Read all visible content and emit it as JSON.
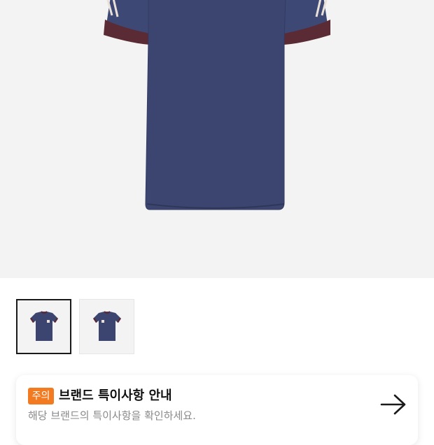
{
  "product": {
    "main_image": "navy-jersey-front",
    "colors": {
      "body": "#3b4570",
      "cuff": "#5a2a35",
      "background": "#f3f3f3"
    }
  },
  "thumbnails": [
    {
      "image": "navy-jersey-front",
      "selected": true
    },
    {
      "image": "navy-jersey-front-alt",
      "selected": false
    }
  ],
  "notice": {
    "badge": "주의",
    "title": "브랜드 특이사항 안내",
    "description": "해당 브랜드의 특이사항을 확인하세요.",
    "icon": "arrow-right-icon",
    "badge_color": "#f27b22"
  }
}
